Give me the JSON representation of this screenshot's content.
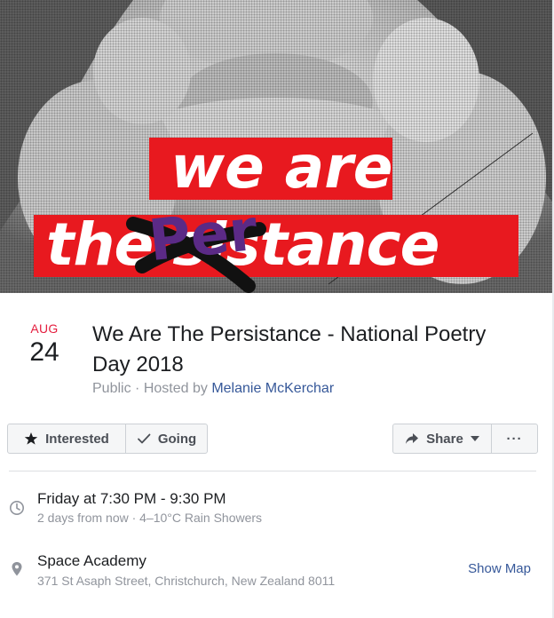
{
  "cover": {
    "banner_line1": "we are",
    "banner_line2": "the sistance",
    "scribble_text": "Per",
    "banner_color": "#e8191f",
    "scribble_color": "#5b2a86"
  },
  "event": {
    "month": "AUG",
    "day": "24",
    "title": "We Are The Persistance - National Poetry Day 2018",
    "privacy": "Public",
    "separator": "·",
    "hosted_by_prefix": "Hosted by",
    "host": "Melanie McKerchar"
  },
  "actions": {
    "interested_label": "Interested",
    "going_label": "Going",
    "share_label": "Share",
    "more_label": "···",
    "icons": [
      "star-icon",
      "checkmark-icon",
      "share-arrow-icon",
      "caret-down-icon"
    ]
  },
  "details": {
    "time_title": "Friday at 7:30 PM - 9:30 PM",
    "time_sub": "2 days from now · 4–10°C Rain Showers",
    "location_title": "Space Academy",
    "location_sub": "371 St Asaph Street, Christchurch, New Zealand 8011",
    "show_map_label": "Show Map",
    "icons": [
      "clock-icon",
      "location-pin-icon"
    ]
  },
  "colors": {
    "link": "#365899",
    "date_red": "#e41e3f",
    "muted": "#90949c"
  }
}
